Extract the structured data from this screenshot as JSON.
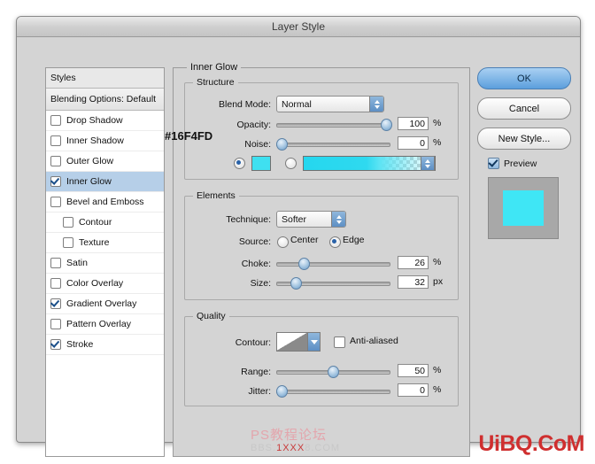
{
  "window": {
    "title": "Layer Style"
  },
  "styles_panel": {
    "header": "Styles",
    "blending": "Blending Options: Default",
    "items": [
      {
        "label": "Drop Shadow",
        "checked": false,
        "selected": false,
        "indent": false
      },
      {
        "label": "Inner Shadow",
        "checked": false,
        "selected": false,
        "indent": false
      },
      {
        "label": "Outer Glow",
        "checked": false,
        "selected": false,
        "indent": false
      },
      {
        "label": "Inner Glow",
        "checked": true,
        "selected": true,
        "indent": false
      },
      {
        "label": "Bevel and Emboss",
        "checked": false,
        "selected": false,
        "indent": false
      },
      {
        "label": "Contour",
        "checked": false,
        "selected": false,
        "indent": true
      },
      {
        "label": "Texture",
        "checked": false,
        "selected": false,
        "indent": true
      },
      {
        "label": "Satin",
        "checked": false,
        "selected": false,
        "indent": false
      },
      {
        "label": "Color Overlay",
        "checked": false,
        "selected": false,
        "indent": false
      },
      {
        "label": "Gradient Overlay",
        "checked": true,
        "selected": false,
        "indent": false
      },
      {
        "label": "Pattern Overlay",
        "checked": false,
        "selected": false,
        "indent": false
      },
      {
        "label": "Stroke",
        "checked": true,
        "selected": false,
        "indent": false
      }
    ]
  },
  "settings": {
    "panel_title": "Inner Glow",
    "structure": {
      "title": "Structure",
      "blend_mode_label": "Blend Mode:",
      "blend_mode_value": "Normal",
      "opacity_label": "Opacity:",
      "opacity_value": "100",
      "opacity_unit": "%",
      "noise_label": "Noise:",
      "noise_value": "0",
      "noise_unit": "%",
      "color_radio_selected": "color",
      "hex_annotation": "#16F4FD"
    },
    "elements": {
      "title": "Elements",
      "technique_label": "Technique:",
      "technique_value": "Softer",
      "source_label": "Source:",
      "source_center": "Center",
      "source_edge": "Edge",
      "source_selected": "Edge",
      "choke_label": "Choke:",
      "choke_value": "26",
      "choke_unit": "%",
      "size_label": "Size:",
      "size_value": "32",
      "size_unit": "px"
    },
    "quality": {
      "title": "Quality",
      "contour_label": "Contour:",
      "anti_aliased_label": "Anti-aliased",
      "anti_aliased_checked": false,
      "range_label": "Range:",
      "range_value": "50",
      "range_unit": "%",
      "jitter_label": "Jitter:",
      "jitter_value": "0",
      "jitter_unit": "%"
    }
  },
  "buttons": {
    "ok": "OK",
    "cancel": "Cancel",
    "new_style": "New Style...",
    "preview": "Preview"
  },
  "watermarks": {
    "ps": "PS教程论坛",
    "bbs_prefix": "BBS.",
    "bbs_red": "1XXX",
    "bbs_suffix": "8.COM",
    "uibq": "UiBQ.CoM"
  },
  "colors": {
    "glow": "#3fe6f5",
    "selection": "#b6cfe8",
    "accent": "#5d8fc4"
  }
}
